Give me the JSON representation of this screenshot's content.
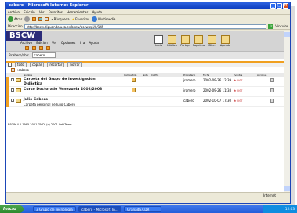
{
  "window": {
    "title": "cabero - Microsoft Internet Explorer"
  },
  "menubar": [
    "Archivo",
    "Edición",
    "Ver",
    "Favoritos",
    "Herramientas",
    "Ayuda"
  ],
  "toolbar": {
    "back_label": "Atrás",
    "search_label": "Búsqueda",
    "favorites_label": "Favoritos",
    "multimedia_label": "Multimedia"
  },
  "address": {
    "label": "Dirección",
    "value": "http://bscw.dipuanda.uca.es/bscw/bscw.cgi/0/145",
    "go_label": "Ir",
    "links_label": "Vínculos"
  },
  "bscw": {
    "logo": "BSCW",
    "menu": [
      "Archivo",
      "Edición",
      "Ver",
      "Opciones",
      "Ir a",
      "Ayuda"
    ],
    "apps": [
      "Inicio",
      "Público",
      "Portap.",
      "Papelera",
      "Dire.",
      "Agenda"
    ],
    "user_label": "Bcabero/abo:",
    "user_select": "cabero",
    "actions": [
      "todo",
      "copiar",
      "recortar",
      "borrar"
    ],
    "path_label": ":cabero",
    "columns": {
      "name": "Nombre",
      "shared": "Compartido",
      "note": "Nota",
      "size": "Calific.",
      "owner": "Propietario",
      "date": "Fecha",
      "events": "Eventos",
      "actions": "Acciones"
    },
    "rows": [
      {
        "name": "Carpeta del Grupo de Investigación",
        "name2": "Didáctica",
        "owner": "jromero",
        "date": "2002-09-26 12:39",
        "event": "★ ver"
      },
      {
        "name": "Curso Doctorado Venezuela 2002/2003",
        "owner": "jromero",
        "date": "2002-09-26 11:38",
        "event": "★ ver"
      },
      {
        "name": "Julio Cabero",
        "desc": "Carpeta personal de Julio Cabero",
        "owner": "cabero",
        "date": "2002-10-07 17:30",
        "event": "★ ver"
      }
    ],
    "footer": "BSCW 4.0 1995-2001 GMD, (c) 2001 OrbiTeam"
  },
  "status": {
    "zone": "Internet"
  },
  "taskbar": {
    "start": "Inicio",
    "tasks": [
      "3 Grupo de Tecnología ...",
      "cabero - Microsoft In...",
      "Granada.CDR"
    ],
    "clock": "12:03"
  },
  "colors": {
    "accent": "#f0a020",
    "bscw_blue": "#2b2b78",
    "xp_blue": "#245edb"
  }
}
